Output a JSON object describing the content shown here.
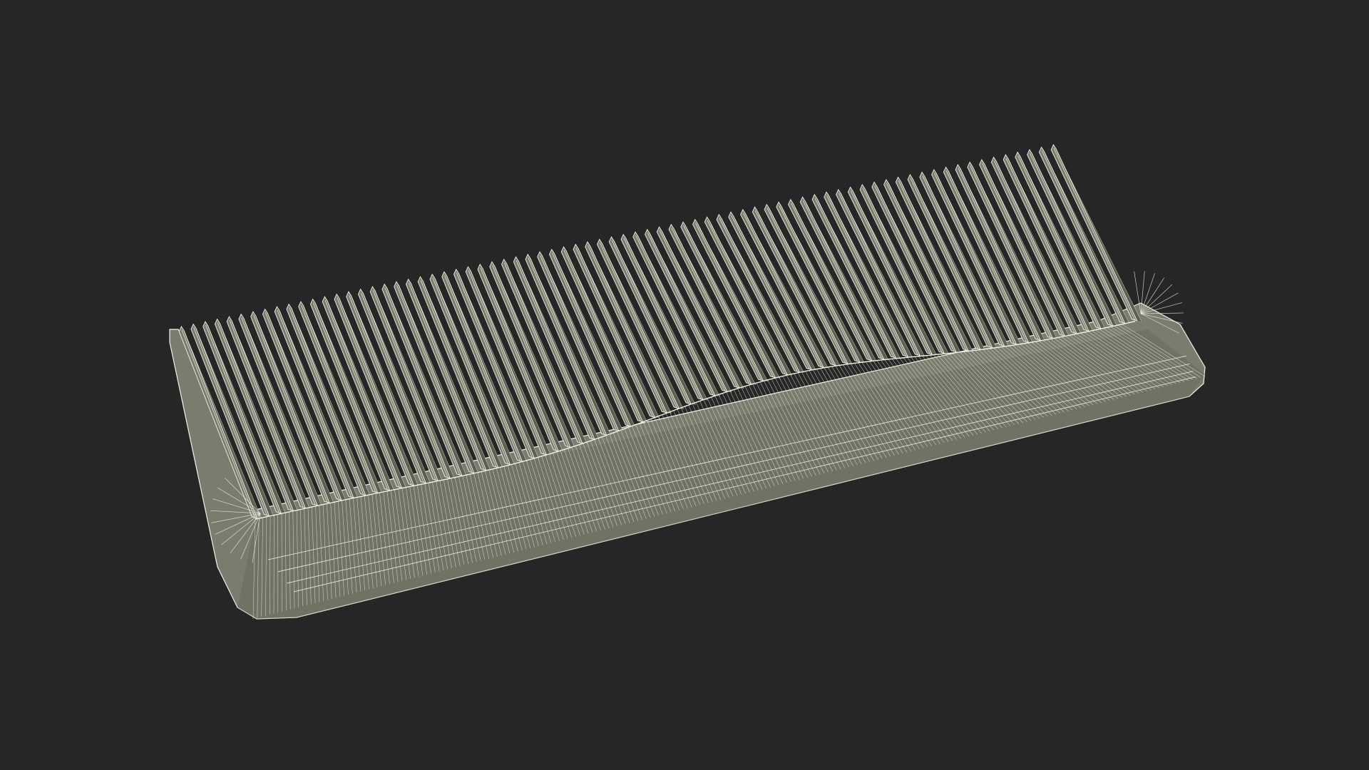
{
  "scene": {
    "subject": "comb-wireframe",
    "background_color": "#262626",
    "surface_color": "#7b7c6e",
    "surface_shadow_color": "#5e5f53",
    "wire_color": "#f2f2e6",
    "tooth_count": 74
  }
}
